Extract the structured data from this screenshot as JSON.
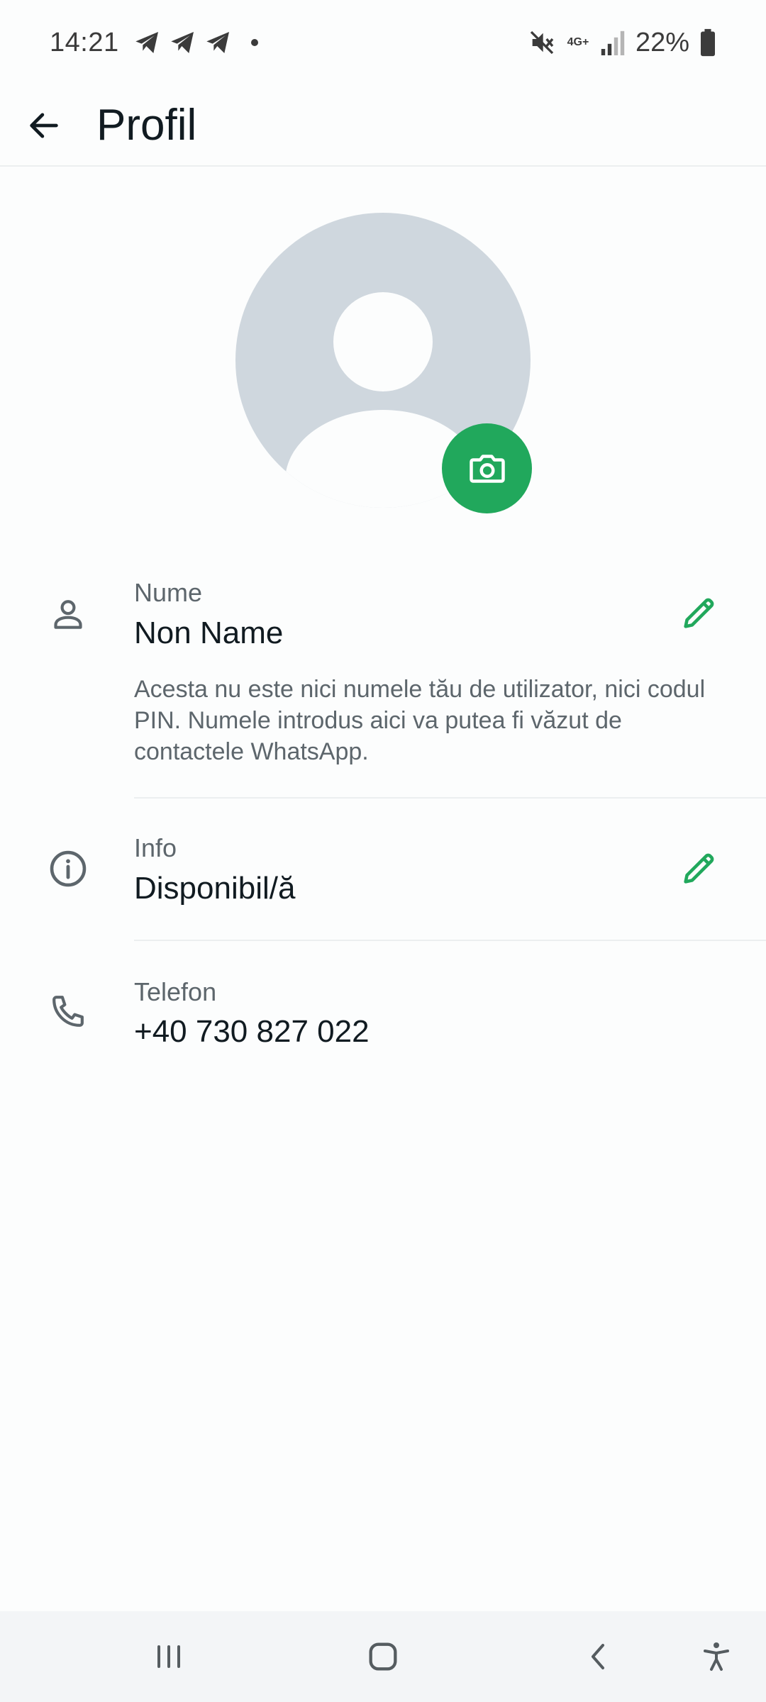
{
  "status_bar": {
    "time": "14:21",
    "battery": "22%",
    "network": "4G+"
  },
  "header": {
    "title": "Profil"
  },
  "profile": {
    "name_label": "Nume",
    "name_value": "Non Name",
    "name_hint": "Acesta nu este nici numele tău de utilizator, nici codul PIN. Numele introdus aici va putea fi văzut de contactele WhatsApp.",
    "info_label": "Info",
    "info_value": "Disponibil/ă",
    "phone_label": "Telefon",
    "phone_value": "+40 730 827 022"
  },
  "colors": {
    "accent": "#21a85c",
    "icon_gray": "#5d666c",
    "avatar_bg": "#cfd7de"
  },
  "icons": [
    "back-arrow-icon",
    "camera-icon",
    "person-icon",
    "info-icon",
    "phone-icon",
    "pencil-icon",
    "telegram-icon",
    "mute-icon",
    "signal-icon",
    "battery-icon",
    "recents-icon",
    "home-icon",
    "nav-back-icon",
    "accessibility-icon"
  ]
}
